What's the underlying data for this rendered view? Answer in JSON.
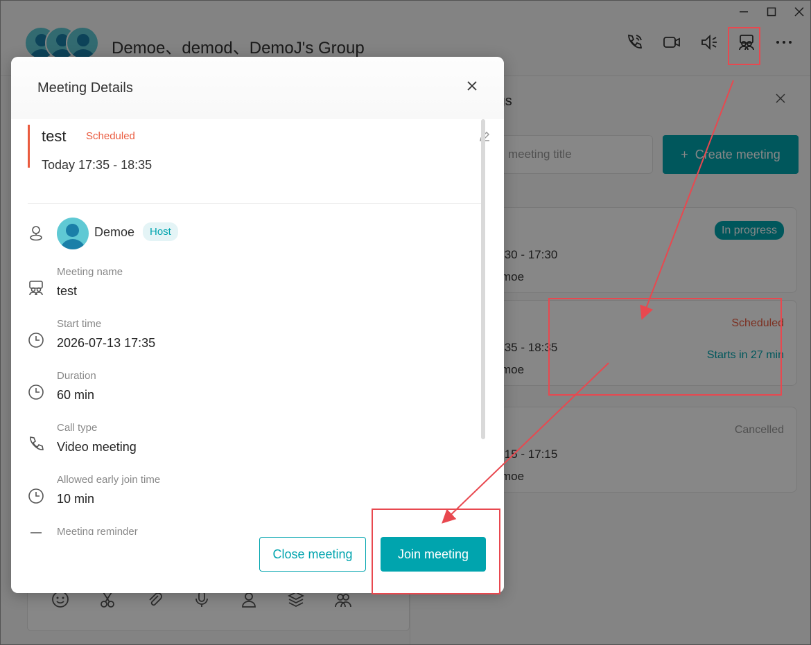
{
  "window": {
    "controls": [
      "minimize-icon",
      "maximize-icon",
      "close-icon"
    ]
  },
  "chat_header": {
    "title": "Demoe、demod、DemoJ's Group",
    "icons": [
      "voice-call-icon",
      "video-call-icon",
      "speaker-icon",
      "meeting-icon",
      "more-icon"
    ]
  },
  "meetings_panel": {
    "title_fragment": "ings",
    "search_placeholder_fragment": "meeting title",
    "create_button": "Create meeting",
    "cards": [
      {
        "status": "In progress",
        "time": ":30 - 17:30",
        "who": "moe",
        "note": ""
      },
      {
        "status": "Scheduled",
        "time": ":35 - 18:35",
        "who": "moe",
        "note": "Starts in 27 min"
      },
      {
        "status": "Cancelled",
        "time": ":15 - 17:15",
        "who": "moe",
        "note": ""
      }
    ]
  },
  "modal": {
    "title": "Meeting Details",
    "summary": {
      "name": "test",
      "status": "Scheduled",
      "time": "Today 17:35 - 18:35"
    },
    "host": {
      "name": "Demoe",
      "badge": "Host"
    },
    "details": [
      {
        "label": "Meeting name",
        "value": "test",
        "icon": "meeting-icon"
      },
      {
        "label": "Start time",
        "value": "2026-07-13 17:35",
        "icon": "clock-icon"
      },
      {
        "label": "Duration",
        "value": "60 min",
        "icon": "clock-icon"
      },
      {
        "label": "Call type",
        "value": "Video meeting",
        "icon": "phone-icon"
      },
      {
        "label": "Allowed early join time",
        "value": "10 min",
        "icon": "clock-icon"
      },
      {
        "label": "Meeting reminder",
        "value": "",
        "icon": "bell-icon"
      }
    ],
    "buttons": {
      "close": "Close meeting",
      "join": "Join meeting"
    }
  },
  "colors": {
    "accent": "#00a4ae",
    "scheduled": "#ea5b3f",
    "annotation": "#e8484f"
  }
}
